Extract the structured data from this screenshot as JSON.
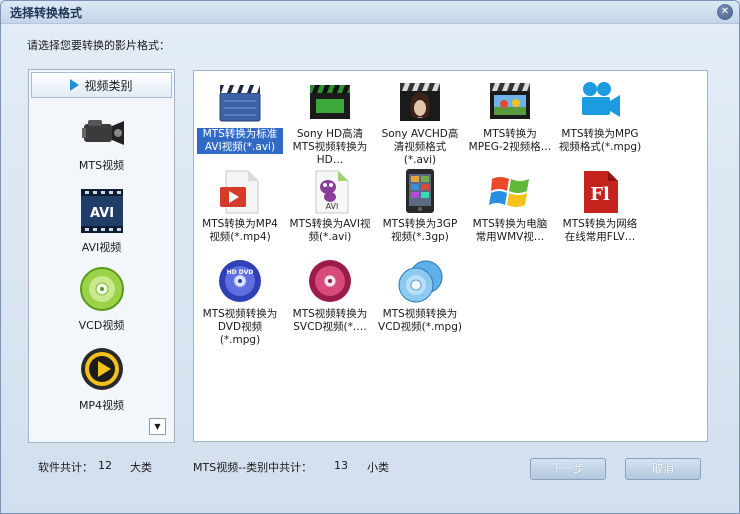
{
  "window": {
    "title": "选择转换格式"
  },
  "prompt": "请选择您要转换的影片格式：",
  "category_header": "视频类别",
  "categories": [
    {
      "label": "MTS视频",
      "icon": "camcorder-icon"
    },
    {
      "label": "AVI视频",
      "icon": "avi-icon"
    },
    {
      "label": "VCD视频",
      "icon": "vcd-disc-icon"
    },
    {
      "label": "MP4视频",
      "icon": "mp4-play-icon"
    }
  ],
  "formats": [
    {
      "caption": "MTS转换为标准AVI视频(*.avi)",
      "icon": "clapperboard-icon",
      "selected": true
    },
    {
      "caption": "Sony HD高清MTS视频转换为HD…",
      "icon": "green-clapperboard-icon"
    },
    {
      "caption": "Sony AVCHD高清视频格式(*.avi)",
      "icon": "movie-clapper-icon"
    },
    {
      "caption": "MTS转换为MPEG-2视频格…",
      "icon": "mpeg-clapper-icon"
    },
    {
      "caption": "MTS转换为MPG视频格式(*.mpg)",
      "icon": "video-camera-icon"
    },
    {
      "caption": "MTS转换为MP4视频(*.mp4)",
      "icon": "video-file-icon"
    },
    {
      "caption": "MTS转换为AVI视频(*.avi)",
      "icon": "avi-mascot-icon"
    },
    {
      "caption": "MTS转换为3GP视频(*.3gp)",
      "icon": "phone-icon"
    },
    {
      "caption": "MTS转换为电脑常用WMV视…",
      "icon": "windows-logo-icon"
    },
    {
      "caption": "MTS转换为网络在线常用FLV…",
      "icon": "flash-icon"
    },
    {
      "caption": "MTS视频转换为DVD视频(*.mpg)",
      "icon": "dvd-disc-icon"
    },
    {
      "caption": "MTS视频转换为SVCD视频(*.…",
      "icon": "svcd-disc-icon"
    },
    {
      "caption": "MTS视频转换为VCD视频(*.mpg)",
      "icon": "vcd-discs-icon"
    }
  ],
  "footer": {
    "software_total_label": "软件共计：",
    "software_total_count": "12",
    "software_total_unit": "大类",
    "category_total_label": "MTS视频--类别中共计：",
    "category_total_count": "13",
    "category_total_unit": "小类"
  },
  "buttons": {
    "next": "下一步",
    "cancel": "取消"
  }
}
